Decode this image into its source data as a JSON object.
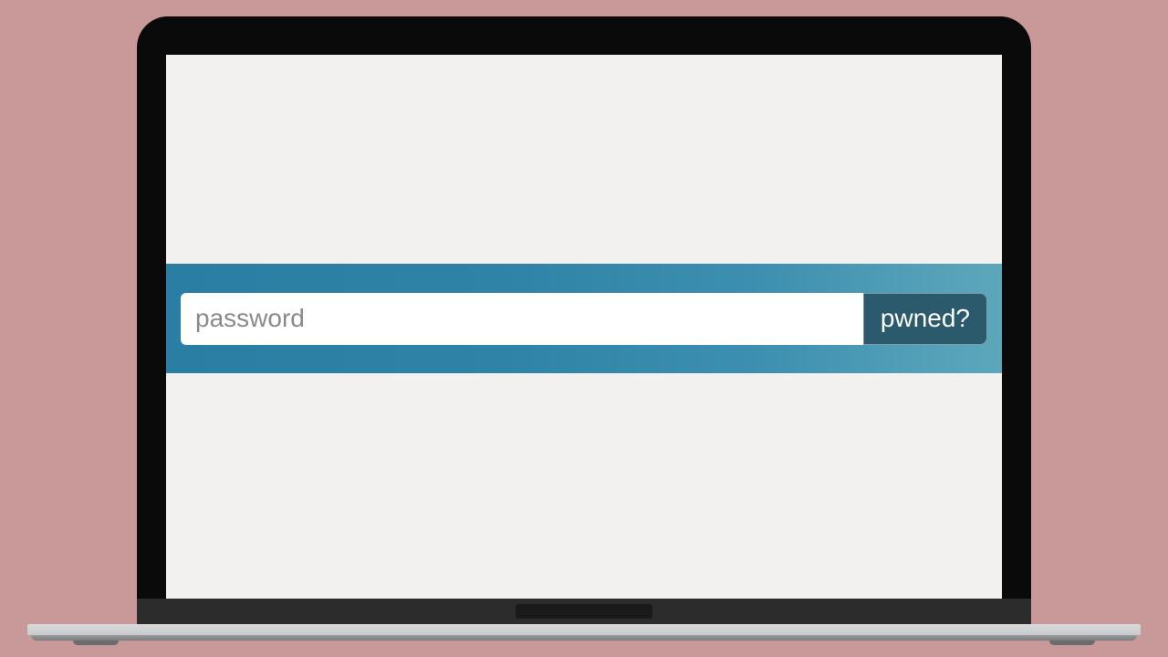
{
  "search": {
    "placeholder": "password",
    "value": "",
    "button_label": "pwned?"
  },
  "colors": {
    "banner_start": "#2a7ea3",
    "banner_end": "#5da7bb",
    "button_bg": "#2a5a6c",
    "page_bg": "#c99999",
    "screen_bg": "#f3f1ef"
  }
}
